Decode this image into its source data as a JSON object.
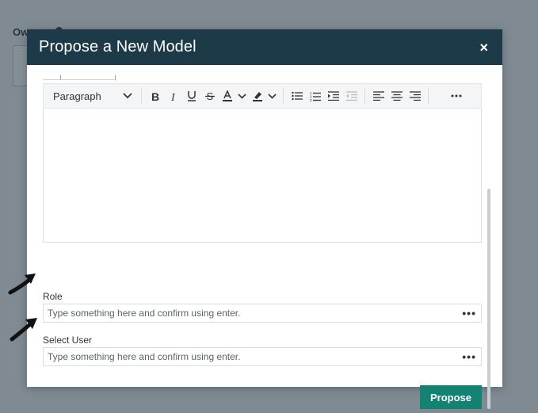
{
  "background": {
    "label": "Ow"
  },
  "modal": {
    "title": "Propose a New Model",
    "close_label": "×"
  },
  "toolbar": {
    "format_select": "Paragraph",
    "items": [
      "bold",
      "italic",
      "underline",
      "strikethrough",
      "text-color",
      "highlight",
      "bullet-list",
      "numbered-list",
      "indent",
      "outdent",
      "align-left",
      "align-center",
      "align-right",
      "more"
    ]
  },
  "fields": {
    "role": {
      "label": "Role",
      "placeholder": "Type something here and confirm using enter.",
      "more": "•••"
    },
    "select_user": {
      "label": "Select User",
      "placeholder": "Type something here and confirm using enter.",
      "more": "•••"
    }
  },
  "actions": {
    "propose_label": "Propose"
  },
  "colors": {
    "header": "#1c3a48",
    "primary_button": "#138272",
    "backdrop": "#7f8a92"
  }
}
